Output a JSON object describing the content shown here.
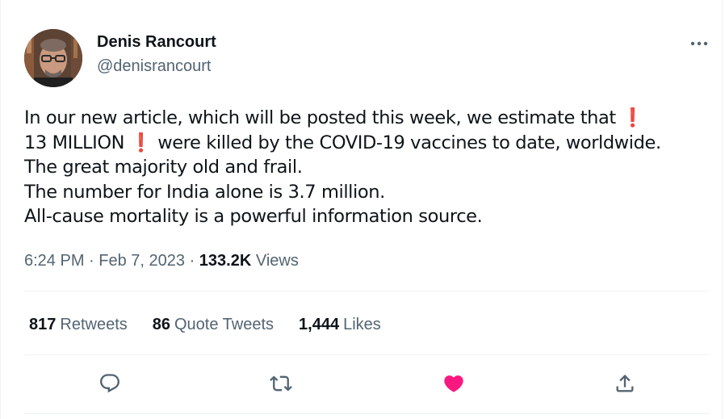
{
  "author": {
    "display_name": "Denis Rancourt",
    "handle": "@denisrancourt"
  },
  "tweet": {
    "line1_a": "In our new article, which will be posted this week, we  estimate that ",
    "line1_excl": "❗",
    "line2_a": "13 MILLION ",
    "line2_excl": "❗",
    "line2_b": "  were killed by the COVID-19 vaccines to date, worldwide.",
    "line3": "The great majority old and frail.",
    "line4": "The number for India alone is 3.7 million.",
    "line5": "All-cause mortality is a powerful information source."
  },
  "meta": {
    "time": "6:24 PM",
    "sep1": " · ",
    "date": "Feb 7, 2023",
    "sep2": " · ",
    "views_count": "133.2K",
    "views_label": " Views"
  },
  "stats": {
    "retweets_count": "817",
    "retweets_label": "Retweets",
    "quotes_count": "86",
    "quotes_label": "Quote Tweets",
    "likes_count": "1,444",
    "likes_label": "Likes"
  },
  "colors": {
    "text": "#0f1419",
    "secondary": "#536471",
    "like_pink": "#f91880",
    "emoji_red": "#dd2e44",
    "divider": "#eff3f4"
  },
  "icons": {
    "more": "more-dots-icon",
    "reply": "reply-icon",
    "retweet": "retweet-icon",
    "like": "heart-filled-icon",
    "share": "share-icon"
  }
}
